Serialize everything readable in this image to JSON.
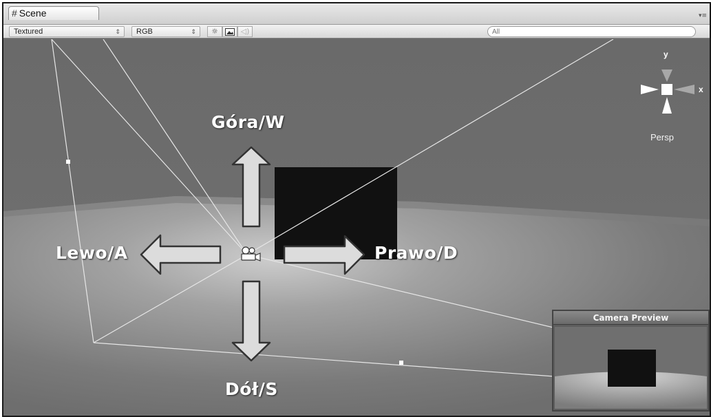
{
  "window": {
    "tab_label": "Scene",
    "tab_menu_glyph": "▾≡"
  },
  "toolbar": {
    "render_mode": "Textured",
    "color_mode": "RGB",
    "search_placeholder": "All",
    "lighting_icon": "sun-icon",
    "image_icon": "image-icon",
    "audio_icon": "speaker-icon"
  },
  "viewport": {
    "labels": {
      "up": "Góra/W",
      "down": "Dół/S",
      "left": "Lewo/A",
      "right": "Prawo/D"
    },
    "gizmo": {
      "y_label": "y",
      "x_label": "x",
      "projection": "Persp"
    }
  },
  "camera_preview": {
    "title": "Camera Preview"
  },
  "colors": {
    "ground": "#6d6d6d",
    "cube": "#111111",
    "arrow_fill": "#d8d8d8",
    "arrow_stroke": "#333333"
  }
}
